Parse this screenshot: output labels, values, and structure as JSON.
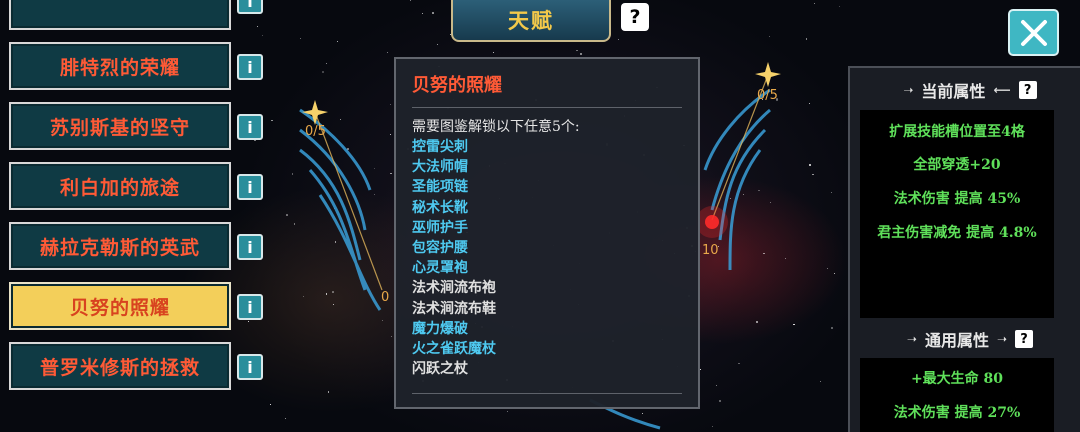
{
  "colors": {
    "side_item_text": "#ff5a36",
    "side_item_bg": "#0f3a44",
    "active_item_bg": "#f3cf5a",
    "tab_text": "#f3c94a",
    "tooltip_title": "#ff5a36",
    "req_unlocked": "#4ec9f0",
    "req_locked": "#e0e0e0",
    "attr_text": "#5fe05a",
    "close_bg": "#3fb7c3"
  },
  "header": {
    "tab_label": "天赋",
    "help_icon": "?",
    "close_icon": "close-icon"
  },
  "sidebar": {
    "items": [
      {
        "label": "",
        "active": false
      },
      {
        "label": "腓特烈的荣耀",
        "active": false
      },
      {
        "label": "苏别斯基的坚守",
        "active": false
      },
      {
        "label": "利白加的旅途",
        "active": false
      },
      {
        "label": "赫拉克勒斯的英武",
        "active": false
      },
      {
        "label": "贝努的照耀",
        "active": true
      },
      {
        "label": "普罗米修斯的拯救",
        "active": false
      }
    ],
    "info_label": "i"
  },
  "constellation": {
    "counts": [
      {
        "label": "0/5"
      },
      {
        "label": "0/5"
      },
      {
        "label": "10"
      },
      {
        "label": "0"
      }
    ]
  },
  "tooltip": {
    "title": "贝努的照耀",
    "requirement": "需要图鉴解锁以下任意5个:",
    "items": [
      {
        "name": "控雷尖刺",
        "unlocked": true
      },
      {
        "name": "大法师帽",
        "unlocked": true
      },
      {
        "name": "圣能项链",
        "unlocked": true
      },
      {
        "name": "秘术长靴",
        "unlocked": true
      },
      {
        "name": "巫师护手",
        "unlocked": true
      },
      {
        "name": "包容护腰",
        "unlocked": true
      },
      {
        "name": "心灵罩袍",
        "unlocked": true
      },
      {
        "name": "法术涧流布袍",
        "unlocked": false
      },
      {
        "name": "法术涧流布鞋",
        "unlocked": false
      },
      {
        "name": "魔力爆破",
        "unlocked": true
      },
      {
        "name": "火之雀跃魔杖",
        "unlocked": true
      },
      {
        "name": "闪跃之杖",
        "unlocked": false
      }
    ]
  },
  "right_panel": {
    "current": {
      "title": "当前属性",
      "attributes": [
        "扩展技能槽位置至4格",
        "全部穿透+20",
        "法术伤害 提高 45%",
        "君主伤害减免 提高 4.8%"
      ]
    },
    "general": {
      "title": "通用属性",
      "attributes": [
        "+最大生命 80",
        "法术伤害 提高 27%"
      ]
    }
  }
}
